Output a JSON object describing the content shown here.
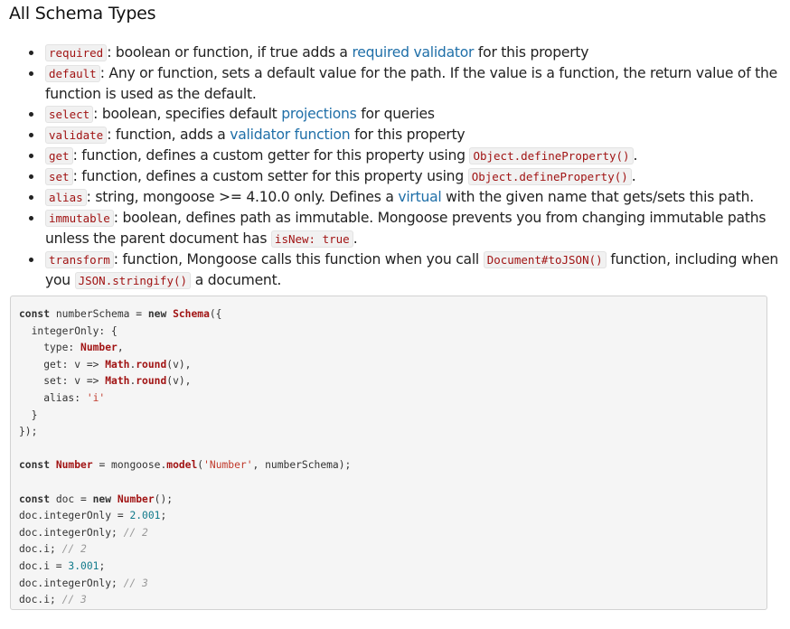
{
  "heading": "All Schema Types",
  "items": [
    {
      "code": "required",
      "text_a": ": boolean or function, if true adds a ",
      "link": "required validator",
      "text_b": " for this property"
    },
    {
      "code": "default",
      "text_a": ": Any or function, sets a default value for the path. If the value is a function, the return value of the function is used as the default."
    },
    {
      "code": "select",
      "text_a": ": boolean, specifies default ",
      "link": "projections",
      "text_b": " for queries"
    },
    {
      "code": "validate",
      "text_a": ": function, adds a ",
      "link": "validator function",
      "text_b": " for this property"
    },
    {
      "code": "get",
      "text_a": ": function, defines a custom getter for this property using ",
      "code2": "Object.defineProperty()",
      "text_b": "."
    },
    {
      "code": "set",
      "text_a": ": function, defines a custom setter for this property using ",
      "code2": "Object.defineProperty()",
      "text_b": "."
    },
    {
      "code": "alias",
      "text_a": ": string, mongoose >= 4.10.0 only. Defines a ",
      "link": "virtual",
      "text_b": " with the given name that gets/sets this path."
    },
    {
      "code": "immutable",
      "text_a": ": boolean, defines path as immutable. Mongoose prevents you from changing immutable paths unless the parent document has ",
      "code2": "isNew: true",
      "text_b": "."
    },
    {
      "code": "transform",
      "text_a": ": function, Mongoose calls this function when you call ",
      "code2": "Document#toJSON()",
      "text_b": " function, including when you ",
      "code3": "JSON.stringify()",
      "text_c": " a document."
    }
  ],
  "code_block": {
    "l1": {
      "kw": "const",
      "a": " numberSchema = ",
      "kw2": "new",
      "cls": "Schema",
      "b": "({"
    },
    "l2": "  integerOnly: {",
    "l3": {
      "a": "    type: ",
      "cls": "Number",
      "b": ","
    },
    "l4": {
      "a": "    get: v => ",
      "cls1": "Math",
      "dot": ".",
      "cls2": "round",
      "b": "(v),"
    },
    "l5": {
      "a": "    set: v => ",
      "cls1": "Math",
      "dot": ".",
      "cls2": "round",
      "b": "(v),"
    },
    "l6": {
      "a": "    alias: ",
      "str": "'i'"
    },
    "l7": "  }",
    "l8": "});",
    "l10": {
      "kw": "const",
      "sp": " ",
      "cls": "Number",
      "a": " = mongoose.",
      "cls2": "model",
      "b": "(",
      "str": "'Number'",
      "c": ", numberSchema);"
    },
    "l12": {
      "kw": "const",
      "a": " doc = ",
      "kw2": "new",
      "cls": "Number",
      "b": "();"
    },
    "l13": {
      "a": "doc.integerOnly = ",
      "num": "2.001",
      "b": ";"
    },
    "l14": {
      "a": "doc.integerOnly; ",
      "cmt": "// 2"
    },
    "l15": {
      "a": "doc.i; ",
      "cmt": "// 2"
    },
    "l16": {
      "a": "doc.i = ",
      "num": "3.001",
      "b": ";"
    },
    "l17": {
      "a": "doc.integerOnly; ",
      "cmt": "// 3"
    },
    "l18": {
      "a": "doc.i; ",
      "cmt": "// 3"
    }
  }
}
